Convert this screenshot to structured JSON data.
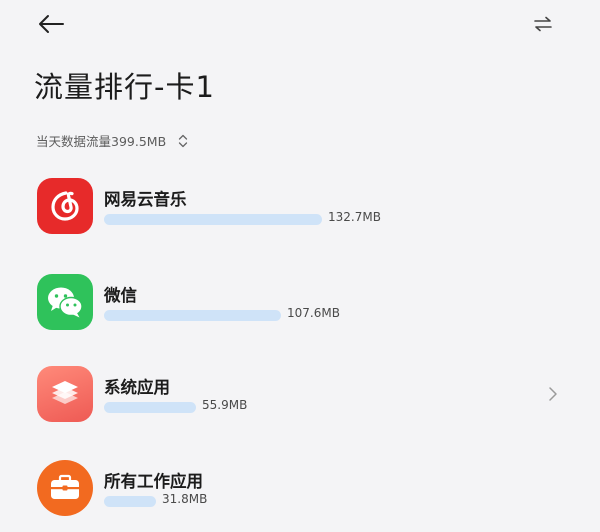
{
  "header": {
    "back_icon": "arrow-left-icon",
    "swap_icon": "swap-arrows-icon",
    "title": "流量排行-卡1"
  },
  "summary": {
    "label": "当天数据流量399.5MB",
    "toggle_icon": "chevron-up-down-icon"
  },
  "apps": [
    {
      "name": "网易云音乐",
      "usage": "132.7MB",
      "usage_mb": 132.7,
      "icon": "netease-cloud-music-icon",
      "icon_color": "#e72a2a"
    },
    {
      "name": "微信",
      "usage": "107.6MB",
      "usage_mb": 107.6,
      "icon": "wechat-icon",
      "icon_color": "#2fc25b"
    },
    {
      "name": "系统应用",
      "usage": "55.9MB",
      "usage_mb": 55.9,
      "icon": "system-apps-icon",
      "icon_color": "#f06c62"
    },
    {
      "name": "所有工作应用",
      "usage": "31.8MB",
      "usage_mb": 31.8,
      "icon": "briefcase-icon",
      "icon_color": "#f26a20"
    }
  ],
  "colors": {
    "background": "#f4f4f6",
    "bar": "#cfe3f8",
    "text": "#1c1c1c"
  }
}
